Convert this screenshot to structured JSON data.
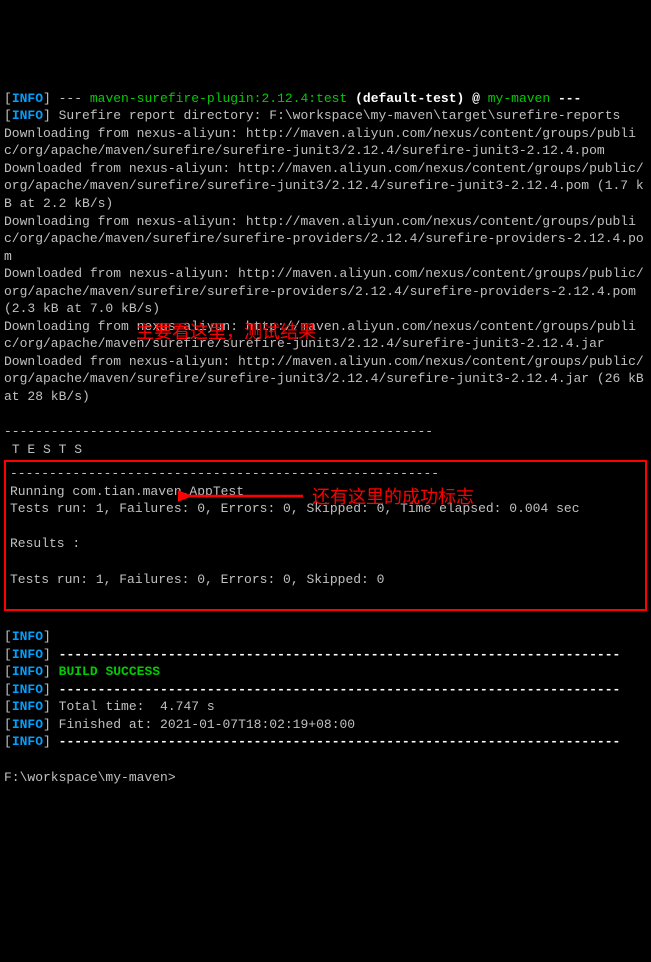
{
  "lines": {
    "l1_a": "[",
    "l1_info": "INFO",
    "l1_b": "] --- ",
    "l1_plugin": "maven-surefire-plugin:2.12.4:test",
    "l1_c": " (default-test) @ ",
    "l1_proj": "my-maven",
    "l1_d": " ---",
    "l2_a": "[",
    "l2_info": "INFO",
    "l2_b": "] Surefire report directory: F:\\workspace\\my-maven\\target\\surefire-reports",
    "l3": "Downloading from nexus-aliyun: http://maven.aliyun.com/nexus/content/groups/public/org/apache/maven/surefire/surefire-junit3/2.12.4/surefire-junit3-2.12.4.pom",
    "l4": "Downloaded from nexus-aliyun: http://maven.aliyun.com/nexus/content/groups/public/org/apache/maven/surefire/surefire-junit3/2.12.4/surefire-junit3-2.12.4.pom (1.7 kB at 2.2 kB/s)",
    "l5": "Downloading from nexus-aliyun: http://maven.aliyun.com/nexus/content/groups/public/org/apache/maven/surefire/surefire-providers/2.12.4/surefire-providers-2.12.4.pom",
    "l6": "Downloaded from nexus-aliyun: http://maven.aliyun.com/nexus/content/groups/public/org/apache/maven/surefire/surefire-providers/2.12.4/surefire-providers-2.12.4.pom (2.3 kB at 7.0 kB/s)",
    "l7": "Downloading from nexus-aliyun: http://maven.aliyun.com/nexus/content/groups/public/org/apache/maven/surefire/surefire-junit3/2.12.4/surefire-junit3-2.12.4.jar",
    "l8": "Downloaded from nexus-aliyun: http://maven.aliyun.com/nexus/content/groups/public/org/apache/maven/surefire/surefire-junit3/2.12.4/surefire-junit3-2.12.4.jar (26 kB at 28 kB/s)",
    "blank": " ",
    "sep": "-------------------------------------------------------",
    "tests_header": " T E S T S",
    "running": "Running com.tian.maven.AppTest",
    "run1": "Tests run: 1, Failures: 0, Errors: 0, Skipped: 0, Time elapsed: 0.004 sec",
    "results": "Results :",
    "run2": "Tests run: 1, Failures: 0, Errors: 0, Skipped: 0",
    "inf_a": "[",
    "inf_info": "INFO",
    "inf_b": "]",
    "dash": " ------------------------------------------------------------------------",
    "build": " BUILD SUCCESS",
    "total": " Total time:  4.747 s",
    "finished": " Finished at: 2021-01-07T18:02:19+08:00",
    "prompt": "F:\\workspace\\my-maven>"
  },
  "annotations": {
    "a1": "主要看这里，测试结果",
    "a2": "还有这里的成功标志"
  }
}
